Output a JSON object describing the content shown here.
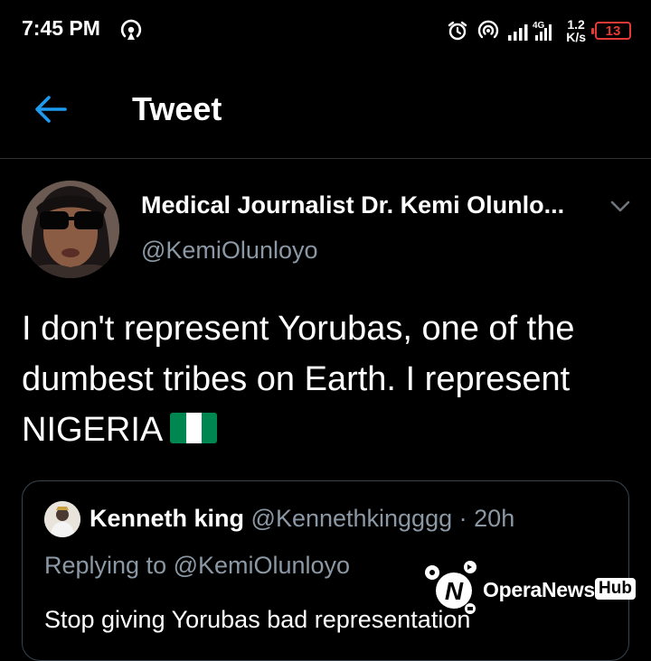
{
  "status_bar": {
    "time": "7:45 PM",
    "network": "4G",
    "speed_value": "1.2",
    "speed_unit": "K/s",
    "battery": "13"
  },
  "header": {
    "title": "Tweet"
  },
  "tweet": {
    "author_name": "Medical Journalist Dr. Kemi Olunlo...",
    "author_handle": "@KemiOlunloyo",
    "text": "I don't represent Yorubas, one of the dumbest tribes on Earth. I represent NIGERIA",
    "flag_icon": "nigeria-flag-icon"
  },
  "quoted_tweet": {
    "author_name": "Kenneth king",
    "author_handle": "@Kennethkingggg",
    "separator": "·",
    "time_ago": "20h",
    "replying_to": "Replying to @KemiOlunloyo",
    "text": "Stop giving Yorubas bad representation"
  },
  "watermark": {
    "brand": "OperaNews",
    "badge": "Hub"
  },
  "colors": {
    "background": "#000000",
    "accent": "#1d9bf0",
    "secondary_text": "#8b98a5",
    "border": "#2f3336",
    "battery_low": "#e53935",
    "flag_green": "#008751"
  }
}
